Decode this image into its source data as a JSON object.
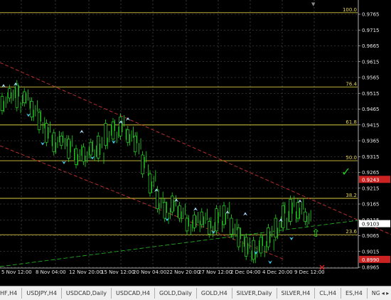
{
  "window": {
    "scroll_marker": "▼"
  },
  "colors": {
    "background": "#000000",
    "grid": "#5a5a5a",
    "candle": "#22dd22",
    "fib": "#d8c840",
    "channel": "#c83232",
    "trendline": "#22aa22",
    "arrow_up": "#aaddff",
    "arrow_down": "#44c8ee",
    "price_box_current": "#ffffff",
    "price_box_red": "#cc2222"
  },
  "price_axis": {
    "labels": [
      "0.9765",
      "0.9715",
      "0.9665",
      "0.9615",
      "0.9565",
      "0.9515",
      "0.9465",
      "0.9415",
      "0.9365",
      "0.9315",
      "0.9265",
      "0.9215",
      "0.9165",
      "0.9115",
      "0.9065",
      "0.9015",
      "0.8965"
    ],
    "current_price": "0.9103",
    "red_box_upper": "0.9243",
    "red_box_lower": "0.8990"
  },
  "fib_levels": [
    {
      "label": "100.0",
      "price": 0.977
    },
    {
      "label": "76.4",
      "price": 0.9535
    },
    {
      "label": "61.8",
      "price": 0.9415
    },
    {
      "label": "50.0",
      "price": 0.9302
    },
    {
      "label": "38.2",
      "price": 0.9183
    },
    {
      "label": "23.6",
      "price": 0.9068
    }
  ],
  "time_axis": {
    "labels": [
      "5 Nov 12:00",
      "8 Nov 04:00",
      "12 Nov 20:00",
      "15 Nov 12:00",
      "20 Nov 04:00",
      "22 Nov 20:00",
      "27 Nov 12:00",
      "2 Dec 04:00",
      "4 Dec 20:00",
      "9 Dec 12:00"
    ]
  },
  "signals": {
    "check_icon": "✓",
    "cross_icon": "✕",
    "up_arrow_icon": "⇧"
  },
  "tabs": [
    {
      "label": "HF,H4"
    },
    {
      "label": "USDJPY,H4"
    },
    {
      "label": "USDCAD,Daily"
    },
    {
      "label": "USDCAD,H4"
    },
    {
      "label": "GOLD,Daily"
    },
    {
      "label": "GOLD,H4"
    },
    {
      "label": "SILVER,Daily"
    },
    {
      "label": "SILVER,H4"
    },
    {
      "label": "CL,H4"
    },
    {
      "label": "ES,H4"
    },
    {
      "label": "NG,Daily"
    }
  ],
  "tab_scroll": "◂ ▸"
}
